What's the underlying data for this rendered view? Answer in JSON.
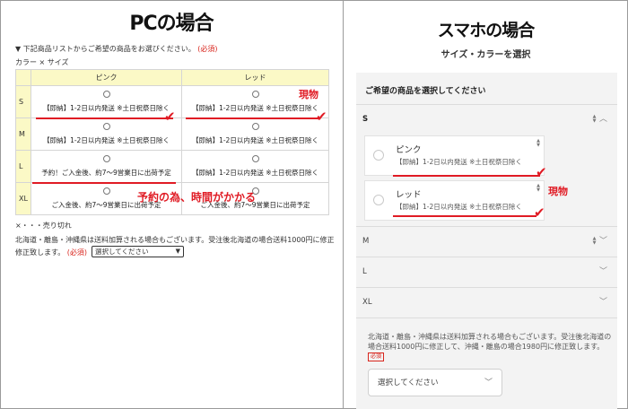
{
  "pc": {
    "title": "PCの場合",
    "instruction": "▼ 下記商品リストからご希望の商品をお選びください。",
    "required_mark": "(必須)",
    "matrix_label": "カラー × サイズ",
    "columns": [
      "ピンク",
      "レッド"
    ],
    "rows": [
      {
        "size": "S",
        "cells": [
          "【即納】1-2日以内発送 ※土日祝祭日除く",
          "【即納】1-2日以内発送 ※土日祝祭日除く"
        ]
      },
      {
        "size": "M",
        "cells": [
          "【即納】1-2日以内発送 ※土日祝祭日除く",
          "【即納】1-2日以内発送 ※土日祝祭日除く"
        ]
      },
      {
        "size": "L",
        "cells": [
          "予約！ご入金後、約7～9営業日に出荷予定",
          "【即納】1-2日以内発送 ※土日祝祭日除く"
        ]
      },
      {
        "size": "XL",
        "cells": [
          "ご入金後、約7～9営業日に出荷予定",
          "ご入金後、約7～9営業日に出荷予定"
        ]
      }
    ],
    "soldout_label": "×・・・売り切れ",
    "shipping_note_1": "北海道・離島・沖縄県は送料加算される場合もございます。受注後北海道の場合送料1000円に修正",
    "shipping_note_2": "修正致します。",
    "shipping_required": "(必須)",
    "select_value": "選択してください",
    "annotation_stock": "現物",
    "annotation_reserve": "予約の為、時間がかかる"
  },
  "sp": {
    "title": "スマホの場合",
    "subtitle": "サイズ・カラーを選択",
    "heading": "ご希望の商品を選択してください",
    "sizes": [
      "S",
      "M",
      "L",
      "XL"
    ],
    "options": [
      {
        "color": "ピンク",
        "info": "【即納】1-2日以内発送 ※土日祝祭日除く"
      },
      {
        "color": "レッド",
        "info": "【即納】1-2日以内発送 ※土日祝祭日除く"
      }
    ],
    "shipping_note": "北海道・離島・沖縄県は送料加算される場合もございます。受注後北海道の場合送料1000円に修正して、沖縄・離島の場合1980円に修正致します。",
    "required_badge": "必須",
    "select_placeholder": "選択してください",
    "annotation_stock": "現物"
  },
  "colors": {
    "accent_red": "#e01b24",
    "table_header": "#fbf9c6",
    "card_bg": "#f3f3f3"
  }
}
